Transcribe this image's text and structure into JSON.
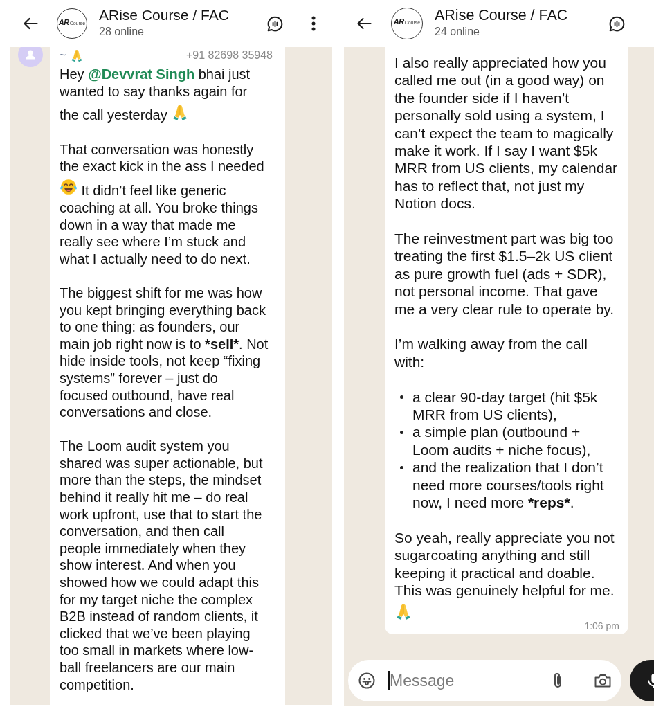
{
  "panels": [
    {
      "header": {
        "title": "ARise Course / FAC",
        "subtitle": "28 online",
        "logo": {
          "mark": "AR",
          "word": "Course"
        },
        "actions": [
          {
            "kind": "voicechat"
          },
          {
            "kind": "menu"
          }
        ]
      },
      "message": {
        "sender": {
          "name": [
            {
              "kind": "text",
              "text": "~"
            },
            {
              "kind": "praying"
            }
          ],
          "phone": "+91 82698 35948"
        },
        "blocks": [
          {
            "kind": "paragraph",
            "parts": [
              {
                "kind": "text",
                "text": "Hey "
              },
              {
                "kind": "mention",
                "text": "@Devvrat Singh"
              },
              {
                "kind": "text",
                "text": " bhai just wanted to say thanks again for the call yesterday "
              },
              {
                "kind": "praying"
              }
            ]
          },
          {
            "kind": "paragraph",
            "parts": [
              {
                "kind": "text",
                "text": "That conversation was honestly the exact kick in the ass I needed "
              },
              {
                "kind": "laughing"
              },
              {
                "kind": "text",
                "text": " It didn’t feel like generic coaching at all. You broke things down in a way that made me really see where I’m stuck and what I actually need to do next."
              }
            ]
          },
          {
            "kind": "paragraph",
            "parts": [
              {
                "kind": "text",
                "text": "The biggest shift for me was how you kept bringing everything back to one thing: as founders, our main job right now is to "
              },
              {
                "kind": "bold",
                "text": "*sell*"
              },
              {
                "kind": "text",
                "text": ". Not hide inside tools, not keep “fixing systems” forever – just do focused outbound, have real conversations and close."
              }
            ]
          },
          {
            "kind": "paragraph",
            "parts": [
              {
                "kind": "text",
                "text": "The Loom audit system you shared was super actionable, but more than the steps, the mindset behind it really hit me – do real work upfront, use that to start the conversation, and then call people immediately when they show interest. And when you showed how we could adapt this for my target niche the complex B2B instead of random clients, it clicked that we’ve been playing too small in markets where low-ball freelancers are our main competition."
              }
            ]
          }
        ]
      }
    },
    {
      "header": {
        "title": "ARise Course / FAC",
        "subtitle": "24 online",
        "logo": {
          "mark": "AR",
          "word": "Course"
        },
        "actions": [
          {
            "kind": "voicechat"
          }
        ]
      },
      "message": {
        "blocks": [
          {
            "kind": "paragraph",
            "parts": [
              {
                "kind": "text",
                "text": "I also really appreciated how you called me out (in a good way) on the founder side if I haven’t personally sold using a system, I can’t expect the team to magically make it work. If I say I want $5k MRR from US clients, my calendar has to reflect that, not just my Notion docs."
              }
            ]
          },
          {
            "kind": "paragraph",
            "parts": [
              {
                "kind": "text",
                "text": "The reinvestment part was big too treating the first $1.5–2k US client as pure growth fuel (ads + SDR), not personal income. That gave me a very clear rule to operate by."
              }
            ]
          },
          {
            "kind": "paragraph",
            "parts": [
              {
                "kind": "text",
                "text": "I’m walking away from the call with:"
              }
            ]
          },
          {
            "kind": "bullets",
            "items": [
              {
                "parts": [
                  {
                    "kind": "text",
                    "text": "a clear 90-day target (hit $5k MRR from US clients),"
                  }
                ]
              },
              {
                "parts": [
                  {
                    "kind": "text",
                    "text": "a simple plan (outbound + Loom audits + niche focus),"
                  }
                ]
              },
              {
                "parts": [
                  {
                    "kind": "text",
                    "text": "and the realization that I don’t need more courses/tools right now, I need more "
                  },
                  {
                    "kind": "bold",
                    "text": "*reps*"
                  },
                  {
                    "kind": "text",
                    "text": "."
                  }
                ]
              }
            ]
          },
          {
            "kind": "paragraph",
            "parts": [
              {
                "kind": "text",
                "text": "So yeah, really appreciate you not sugarcoating anything and still keeping it practical and doable. This was genuinely helpful for me."
              },
              {
                "kind": "break"
              },
              {
                "kind": "praying"
              }
            ]
          }
        ],
        "time": "1:06 pm"
      },
      "composer": {
        "placeholder": "Message",
        "focused": true
      }
    }
  ]
}
